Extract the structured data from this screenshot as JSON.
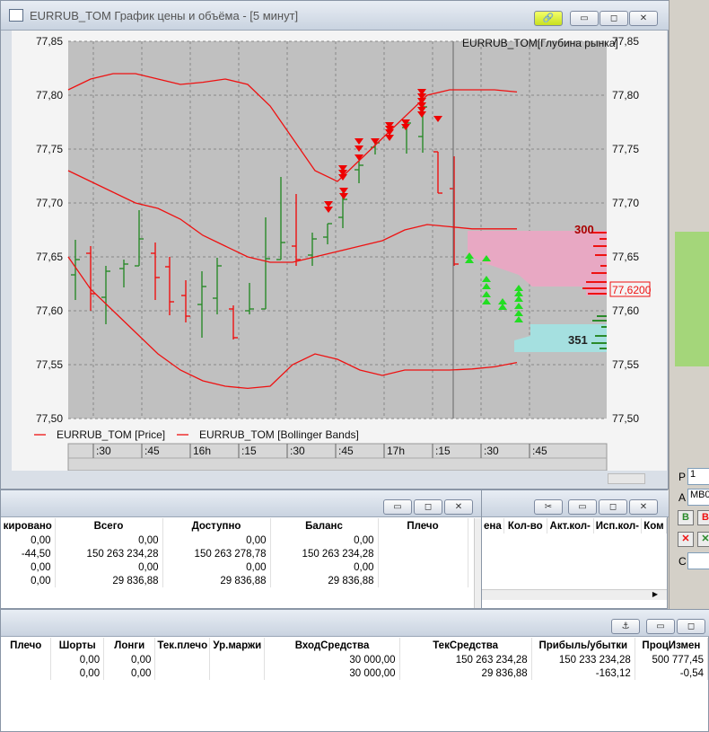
{
  "chart_window": {
    "title": "EURRUB_TOM График цены и объёма - [5 минут]",
    "depth_label": "EURRUB_TOM[Глубина рынка]",
    "legend": [
      "EURRUB_TOM [Price]",
      "EURRUB_TOM [Bollinger Bands]"
    ],
    "current_price": "77,6200",
    "ask_volume": "300",
    "bid_volume": "351",
    "btn_link": "link-icon",
    "btn_min": "▭",
    "btn_max": "◻",
    "btn_close": "✕",
    "colors": {
      "candle_up": "#2a8a2a",
      "candle_down": "#e11",
      "bollinger": "#e11",
      "ask_depth": "#e8a8c3",
      "bid_depth": "#a5e0e0",
      "plot_bg": "#c0c0c0"
    }
  },
  "chart_data": {
    "type": "line",
    "ylim": [
      77.5,
      77.85
    ],
    "yticks": [
      "77,85",
      "77,80",
      "77,75",
      "77,70",
      "77,65",
      "77,60",
      "77,55",
      "77,50"
    ],
    "time_ticks": [
      ":30",
      ":45",
      "16h",
      ":15",
      ":30",
      ":45",
      "17h",
      ":15",
      ":30",
      ":45"
    ],
    "bollinger_upper": [
      77.805,
      77.815,
      77.82,
      77.82,
      77.815,
      77.81,
      77.812,
      77.815,
      77.81,
      77.79,
      77.76,
      77.73,
      77.72,
      77.74,
      77.76,
      77.78,
      77.8,
      77.805,
      77.805,
      77.805,
      77.803
    ],
    "bollinger_middle": [
      77.73,
      77.72,
      77.71,
      77.7,
      77.695,
      77.685,
      77.67,
      77.66,
      77.65,
      77.645,
      77.645,
      77.65,
      77.655,
      77.66,
      77.665,
      77.675,
      77.68,
      77.678,
      77.676,
      77.676,
      77.676
    ],
    "bollinger_lower": [
      77.65,
      77.62,
      77.6,
      77.58,
      77.56,
      77.545,
      77.535,
      77.53,
      77.528,
      77.53,
      77.55,
      77.56,
      77.555,
      77.545,
      77.54,
      77.545,
      77.545,
      77.545,
      77.546,
      77.548,
      77.552
    ]
  },
  "account_window": {
    "headers": [
      "кировано",
      "Всего",
      "Доступно",
      "Баланс",
      "Плечо"
    ],
    "rows": [
      [
        "0,00",
        "0,00",
        "0,00",
        "0,00",
        ""
      ],
      [
        "-44,50",
        "150 263 234,28",
        "150 263 278,78",
        "150 263 234,28",
        ""
      ],
      [
        "0,00",
        "0,00",
        "0,00",
        "0,00",
        ""
      ],
      [
        "0,00",
        "29 836,88",
        "29 836,88",
        "29 836,88",
        ""
      ]
    ]
  },
  "orders_window": {
    "headers": [
      "ена",
      "Кол-во",
      "Акт.кол-",
      "Исп.кол-",
      "Ком"
    ]
  },
  "limits_window": {
    "headers": [
      "Плечо",
      "Шорты",
      "Лонги",
      "Тек.плечо",
      "Ур.маржи",
      "ВходСредства",
      "ТекСредства",
      "Прибыль/убытки",
      "ПроцИзмен"
    ],
    "rows": [
      [
        "",
        "0,00",
        "0,00",
        "",
        "",
        "30 000,00",
        "150 263 234,28",
        "150 233 234,28",
        "500 777,45"
      ],
      [
        "",
        "0,00",
        "0,00",
        "",
        "",
        "30 000,00",
        "29 836,88",
        "-163,12",
        "-0,54"
      ]
    ]
  },
  "right_panel": {
    "p_label": "P",
    "p_value": "1",
    "a_label": "A",
    "a_value": "MB0",
    "c_label": "C",
    "btn_b": "B",
    "btn_b2": "B"
  }
}
